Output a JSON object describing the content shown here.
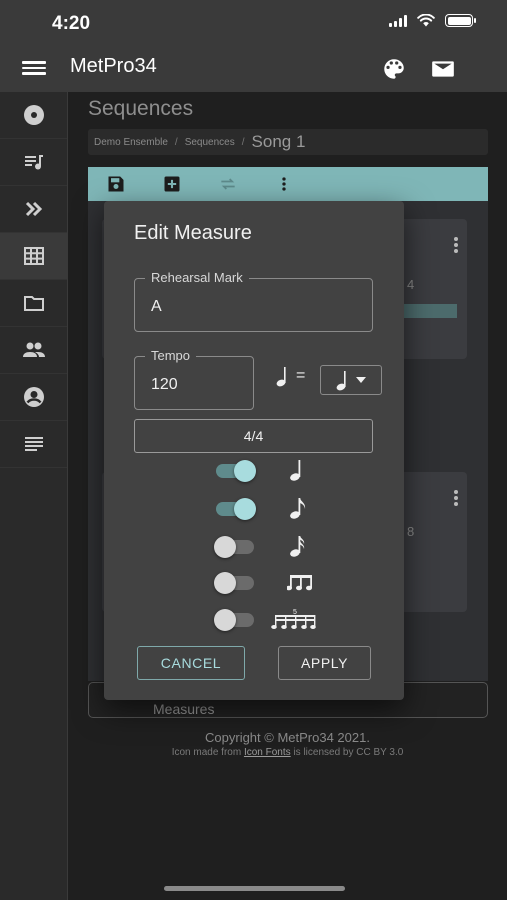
{
  "status_bar": {
    "time": "4:20",
    "icons": [
      "signal-icon",
      "wifi-icon",
      "battery-icon"
    ]
  },
  "app_bar": {
    "title": "MetPro34",
    "icons": [
      "menu-icon",
      "palette-icon",
      "mail-icon"
    ]
  },
  "sidebar": {
    "items": [
      {
        "icon": "disc-icon"
      },
      {
        "icon": "playlist-icon"
      },
      {
        "icon": "double-chevron-icon"
      },
      {
        "icon": "grid-icon",
        "active": true
      },
      {
        "icon": "folder-icon"
      },
      {
        "icon": "people-icon"
      },
      {
        "icon": "account-icon"
      },
      {
        "icon": "list-icon"
      }
    ]
  },
  "main": {
    "page_title": "Sequences",
    "breadcrumb": [
      "Demo Ensemble",
      "Sequences",
      "Song 1"
    ],
    "toolbar": [
      "save-icon",
      "add-box-icon",
      "repeat-icon",
      "more-vert-icon"
    ],
    "card1_text": "4",
    "card2_text": "8",
    "measures_label": "Measures",
    "copyright": "Copyright © MetPro34 2021.",
    "icon_credit": {
      "prefix": "Icon made from",
      "link": "Icon Fonts",
      "suffix": "is licensed by CC BY 3.0"
    }
  },
  "dialog": {
    "title": "Edit Measure",
    "rehearsal_mark": {
      "label": "Rehearsal Mark",
      "value": "A"
    },
    "tempo": {
      "label": "Tempo",
      "value": "120"
    },
    "equals": "=",
    "time_signature": "4/4",
    "subdivisions": [
      {
        "note": "quarter-note-icon",
        "enabled": true
      },
      {
        "note": "eighth-note-icon",
        "enabled": true
      },
      {
        "note": "sixteenth-note-icon",
        "enabled": false
      },
      {
        "note": "triplet-icon",
        "enabled": false
      },
      {
        "note": "quintuplet-icon",
        "enabled": false
      }
    ],
    "cancel_label": "CANCEL",
    "apply_label": "APPLY",
    "colors": {
      "accent": "#a8dcde",
      "toolbar": "#7fb6b7",
      "dialog": "#424242"
    }
  }
}
